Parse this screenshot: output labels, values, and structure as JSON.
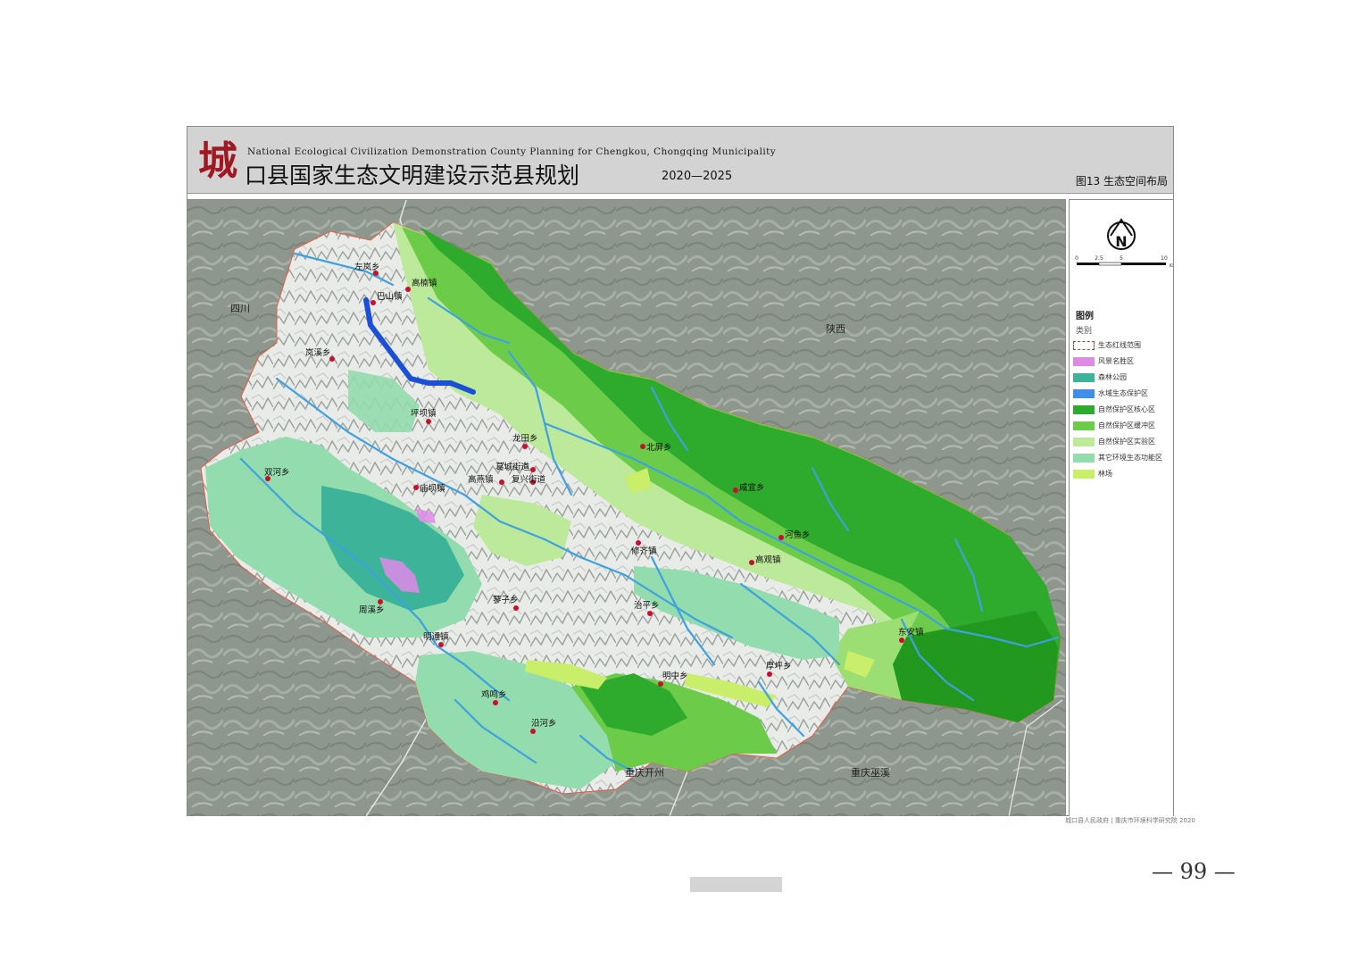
{
  "header": {
    "logo_char": "城",
    "title_en": "National Ecological Civilization Demonstration County Planning for Chengkou, Chongqing Municipality",
    "title_cn": "口县国家生态文明建设示范县规划",
    "years": "2020—2025",
    "figure_label": "图13  生态空间布局"
  },
  "map": {
    "regions": [
      "四川",
      "陕西",
      "重庆开州",
      "重庆巫溪"
    ],
    "places": [
      "左岚乡",
      "高楠镇",
      "巴山镇",
      "岚溪乡",
      "坪坝镇",
      "龙田乡",
      "北屏乡",
      "双河乡",
      "庙坝镇",
      "葛城街道",
      "高燕镇",
      "复兴街道",
      "咸宜乡",
      "修齐镇",
      "高观镇",
      "河鱼乡",
      "蓼子乡",
      "周溪乡",
      "治平乡",
      "明通镇",
      "东安镇",
      "明中乡",
      "厚坪乡",
      "鸡鸣乡",
      "沿河乡"
    ],
    "place_colors": {
      "river": "#3ea1e0",
      "main_river": "#1c4fd8",
      "town": "#c8102e"
    }
  },
  "compass": {
    "letter": "N",
    "scale_ticks": [
      "0",
      "2.5",
      "5",
      "10"
    ],
    "scale_unit": "KM"
  },
  "legend": {
    "title": "图例",
    "subtitle": "类别",
    "items": [
      {
        "label": "生态红线范围",
        "color": "#ffffff"
      },
      {
        "label": "风景名胜区",
        "color": "#e08ae8"
      },
      {
        "label": "森林公园",
        "color": "#3db39a"
      },
      {
        "label": "水域生态保护区",
        "color": "#3f8fe6"
      },
      {
        "label": "自然保护区核心区",
        "color": "#2eaa2c"
      },
      {
        "label": "自然保护区缓冲区",
        "color": "#6ccc4a"
      },
      {
        "label": "自然保护区实验区",
        "color": "#bde99a"
      },
      {
        "label": "其它环境生态功能区",
        "color": "#93dcad"
      },
      {
        "label": "林场",
        "color": "#c9ef6a"
      }
    ]
  },
  "credit": "城口县人民政府 | 重庆市环境科学研究院 2020",
  "page_number": "— 99 —"
}
